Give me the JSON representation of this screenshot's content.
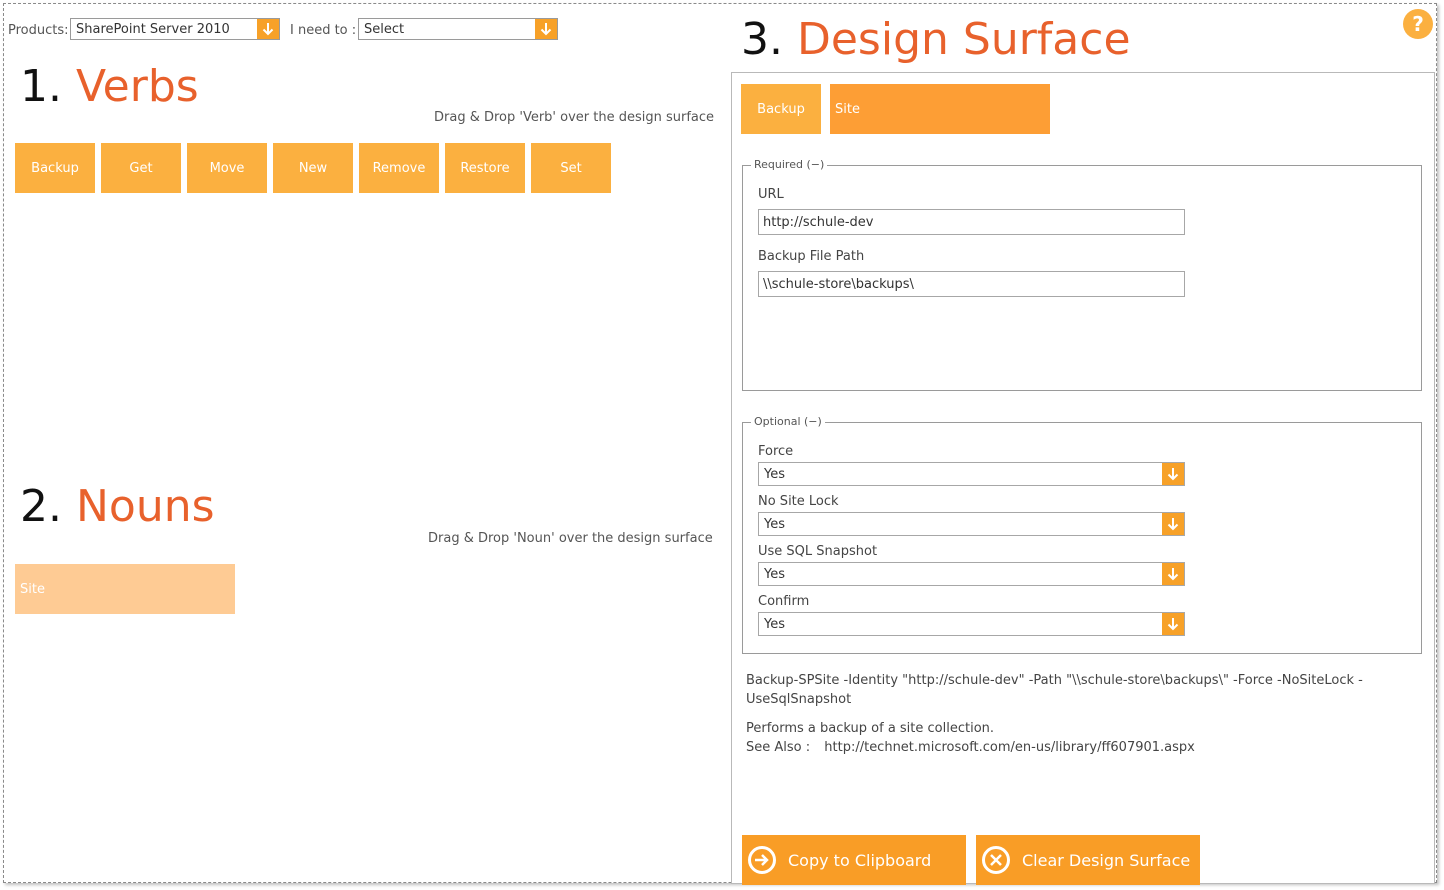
{
  "toolbar": {
    "products_label": "Products:",
    "products_value": "SharePoint Server 2010",
    "need_label": "I need to :",
    "need_value": "Select"
  },
  "verbs": {
    "num": "1.",
    "title": "Verbs",
    "hint": "Drag & Drop 'Verb' over the design surface",
    "items": [
      "Backup",
      "Get",
      "Move",
      "New",
      "Remove",
      "Restore",
      "Set"
    ]
  },
  "nouns": {
    "num": "2.",
    "title": "Nouns",
    "hint": "Drag & Drop 'Noun' over the design surface",
    "items": [
      "Site"
    ]
  },
  "design": {
    "num": "3.",
    "title": "Design Surface",
    "verb_tile": "Backup",
    "noun_tile": "Site",
    "required": {
      "legend": "Required (−)",
      "url_label": "URL",
      "url_value": "http://schule-dev",
      "path_label": "Backup File Path",
      "path_value": "\\\\schule-store\\backups\\"
    },
    "optional": {
      "legend": "Optional (−)",
      "fields": [
        {
          "label": "Force",
          "value": "Yes"
        },
        {
          "label": "No Site Lock",
          "value": "Yes"
        },
        {
          "label": "Use SQL Snapshot",
          "value": "Yes"
        },
        {
          "label": "Confirm",
          "value": "Yes"
        }
      ]
    },
    "command_line1": "Backup-SPSite -Identity \"http://schule-dev\" -Path \"\\\\schule-store\\backups\\\" -Force -NoSiteLock -",
    "command_line2": "UseSqlSnapshot",
    "description": "Performs a backup of a site collection.",
    "see_also_label": "See Also :",
    "see_also_link": "http://technet.microsoft.com/en-us/library/ff607901.aspx",
    "copy_button": "Copy to Clipboard",
    "clear_button": "Clear Design Surface"
  },
  "help": {
    "label": "?"
  },
  "colors": {
    "accent": "#f7a128",
    "tile": "#fbb040",
    "title": "#e8612c",
    "noun_tile": "#fecb94"
  }
}
